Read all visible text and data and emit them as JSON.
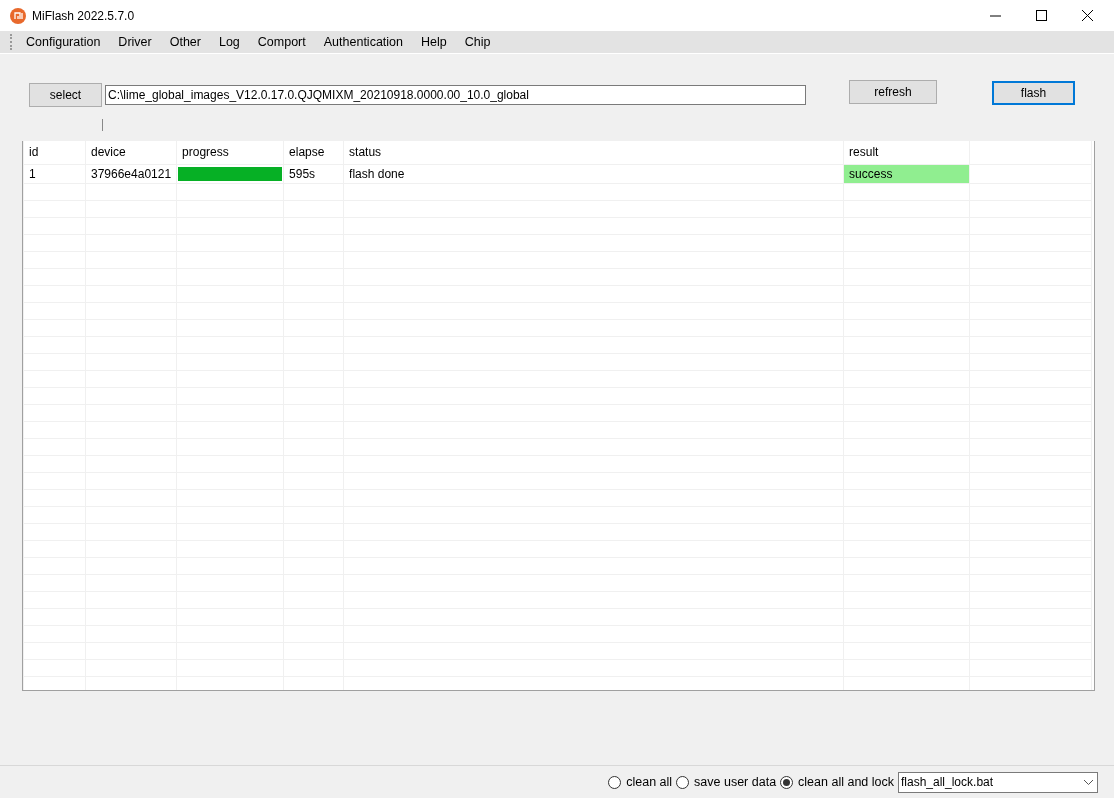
{
  "window": {
    "title": "MiFlash 2022.5.7.0"
  },
  "menu": [
    "Configuration",
    "Driver",
    "Other",
    "Log",
    "Comport",
    "Authentication",
    "Help",
    "Chip"
  ],
  "toolbar": {
    "select_button": "select",
    "path": "C:\\lime_global_images_V12.0.17.0.QJQMIXM_20210918.0000.00_10.0_global",
    "refresh_button": "refresh",
    "flash_button": "flash"
  },
  "table": {
    "columns": [
      "id",
      "device",
      "progress",
      "elapse",
      "status",
      "result"
    ],
    "rows": [
      {
        "id": "1",
        "device": "37966e4a0121",
        "level": 1,
        "elapse": "595s",
        "status": "flash done",
        "result": "success",
        "color": "#90ee90"
      }
    ]
  },
  "options": [
    {
      "label": "clean all",
      "selected": false
    },
    {
      "label": "save user data",
      "selected": false
    },
    {
      "label": "clean all and lock",
      "selected": true
    }
  ],
  "script_select": {
    "value": "flash_all_lock.bat"
  }
}
